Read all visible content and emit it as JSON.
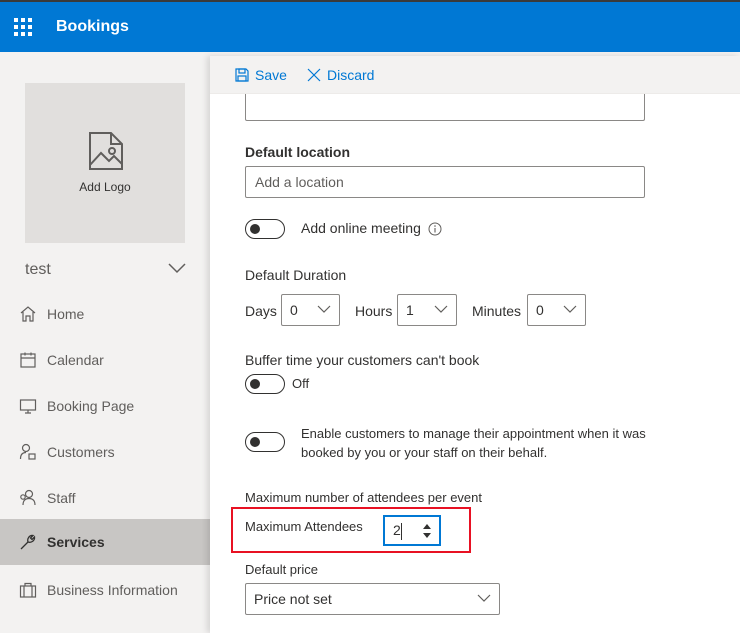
{
  "app": {
    "title": "Bookings"
  },
  "sidebar": {
    "logo_label": "Add Logo",
    "business_name": "test",
    "items": [
      {
        "label": "Home",
        "icon": "home-icon",
        "active": false
      },
      {
        "label": "Calendar",
        "icon": "calendar-icon",
        "active": false
      },
      {
        "label": "Booking Page",
        "icon": "monitor-icon",
        "active": false
      },
      {
        "label": "Customers",
        "icon": "customers-icon",
        "active": false
      },
      {
        "label": "Staff",
        "icon": "staff-icon",
        "active": false
      },
      {
        "label": "Services",
        "icon": "wrench-icon",
        "active": true
      },
      {
        "label": "Business Information",
        "icon": "briefcase-icon",
        "active": false
      }
    ]
  },
  "commandbar": {
    "save": "Save",
    "discard": "Discard"
  },
  "form": {
    "default_location": {
      "label": "Default location",
      "placeholder": "Add a location"
    },
    "online_meeting": {
      "label": "Add online meeting",
      "on": false
    },
    "duration": {
      "label": "Default Duration",
      "days_label": "Days",
      "days_value": "0",
      "hours_label": "Hours",
      "hours_value": "1",
      "minutes_label": "Minutes",
      "minutes_value": "0"
    },
    "buffer": {
      "label": "Buffer time your customers can't book",
      "state": "Off"
    },
    "manage": {
      "label": "Enable customers to manage their appointment when it was booked by you or your staff on their behalf."
    },
    "attendees": {
      "section_label": "Maximum number of attendees per event",
      "field_label": "Maximum Attendees",
      "value": "2"
    },
    "price": {
      "label": "Default price",
      "value": "Price not set"
    }
  },
  "colors": {
    "brand": "#0078d4",
    "highlight": "#e81123",
    "active_nav": "#c8c6c4"
  }
}
